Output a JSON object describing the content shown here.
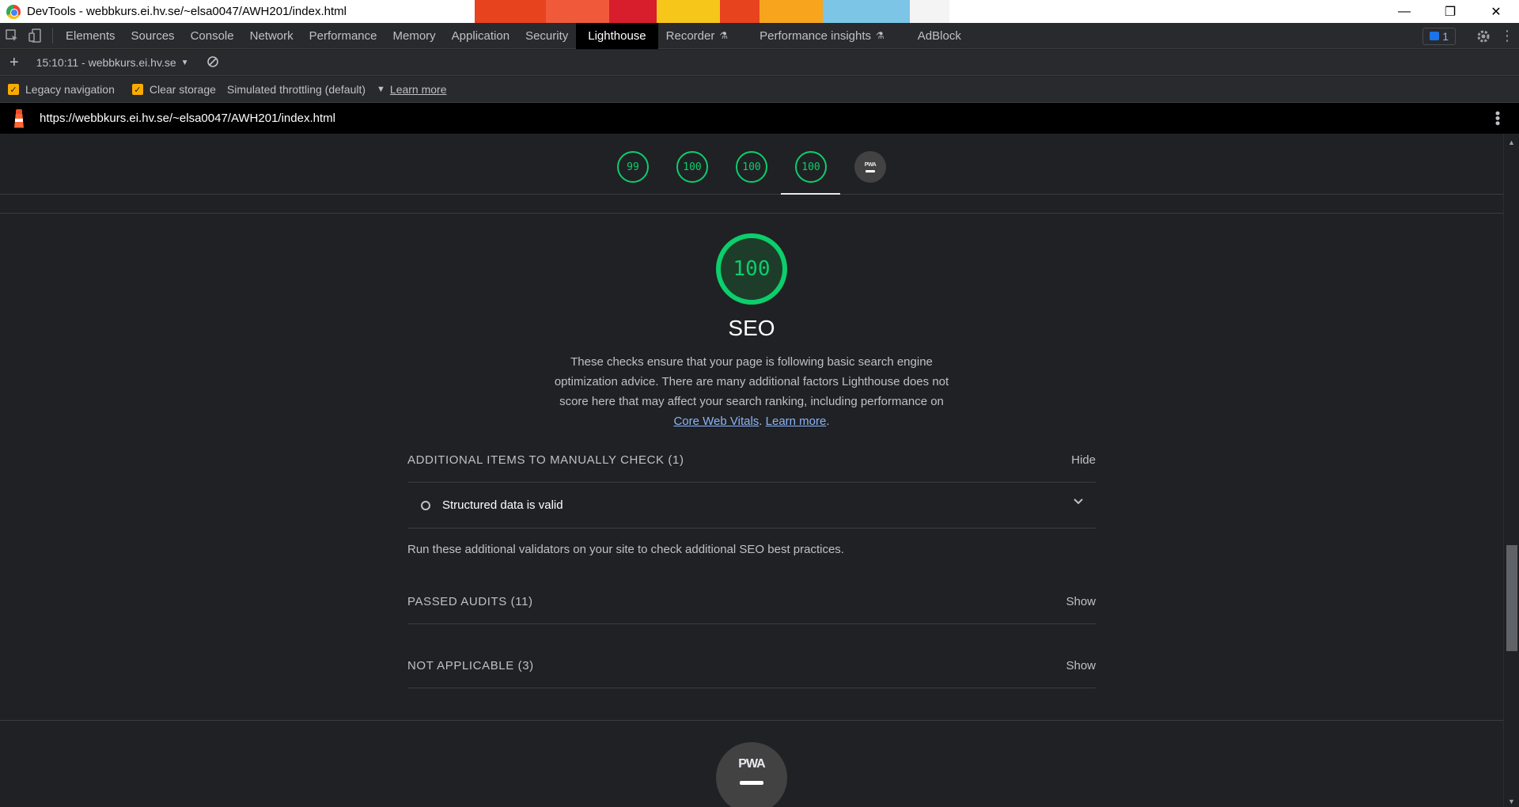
{
  "window": {
    "title": "DevTools - webbkurs.ei.hv.se/~elsa0047/AWH201/index.html",
    "controls": [
      "minimize-icon",
      "restore-icon",
      "close-icon"
    ]
  },
  "tabs": [
    {
      "label": "Elements"
    },
    {
      "label": "Sources"
    },
    {
      "label": "Console"
    },
    {
      "label": "Network"
    },
    {
      "label": "Performance"
    },
    {
      "label": "Memory"
    },
    {
      "label": "Application"
    },
    {
      "label": "Security"
    },
    {
      "label": "Lighthouse",
      "active": true
    },
    {
      "label": "Recorder",
      "experimental": true
    },
    {
      "label": "Performance insights",
      "experimental": true
    },
    {
      "label": "AdBlock"
    }
  ],
  "issues_badge": "1",
  "toolbar": {
    "report_selector": "15:10:11 - webbkurs.ei.hv.se",
    "legacy_navigation": "Legacy navigation",
    "clear_storage": "Clear storage",
    "throttling": "Simulated throttling (default)",
    "learn_more": "Learn more"
  },
  "url": "https://webbkurs.ei.hv.se/~elsa0047/AWH201/index.html",
  "summary_scores": [
    "99",
    "100",
    "100",
    "100"
  ],
  "summary_pwa": "PWA",
  "category": {
    "score": "100",
    "title": "SEO",
    "description": "These checks ensure that your page is following basic search engine optimization advice. There are many additional factors Lighthouse does not score here that may affect your search ranking, including performance on",
    "link_cwv": "Core Web Vitals",
    "sep": ".",
    "link_learn": "Learn more",
    "end": "."
  },
  "groups": {
    "manual": {
      "title": "ADDITIONAL ITEMS TO MANUALLY CHECK (1)",
      "toggle": "Hide"
    },
    "manual_audit": "Structured data is valid",
    "validators": "Run these additional validators on your site to check additional SEO best practices.",
    "passed": {
      "title": "PASSED AUDITS (11)",
      "toggle": "Show"
    },
    "na": {
      "title": "NOT APPLICABLE (3)",
      "toggle": "Show"
    }
  },
  "pwa_label": "PWA",
  "colors": {
    "pass": "#0cce6b",
    "accent": "#f9ab00",
    "link": "#8ab4f8"
  }
}
